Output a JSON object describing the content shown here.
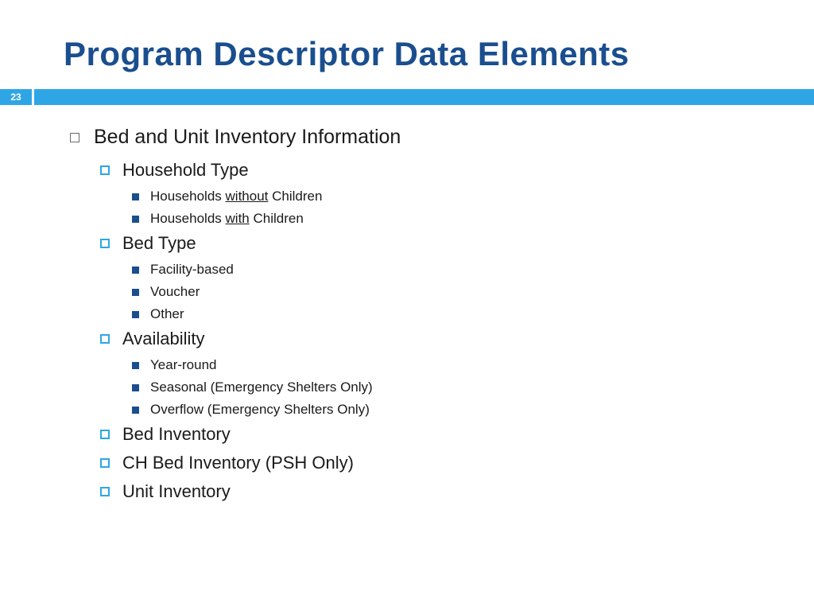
{
  "slide_number": "23",
  "title": "Program Descriptor Data Elements",
  "l1": "Bed and Unit Inventory Information",
  "household_type": {
    "label": "Household Type",
    "items": [
      {
        "pre": "Households ",
        "ul": "without",
        "post": " Children"
      },
      {
        "pre": "Households ",
        "ul": "with",
        "post": " Children"
      }
    ]
  },
  "bed_type": {
    "label": "Bed Type",
    "items": [
      "Facility-based",
      "Voucher",
      "Other"
    ]
  },
  "availability": {
    "label": "Availability",
    "items": [
      "Year-round",
      "Seasonal (Emergency Shelters Only)",
      "Overflow (Emergency Shelters Only)"
    ]
  },
  "bed_inventory": "Bed Inventory",
  "ch_bed_inventory": "CH Bed Inventory (PSH Only)",
  "unit_inventory": "Unit Inventory"
}
